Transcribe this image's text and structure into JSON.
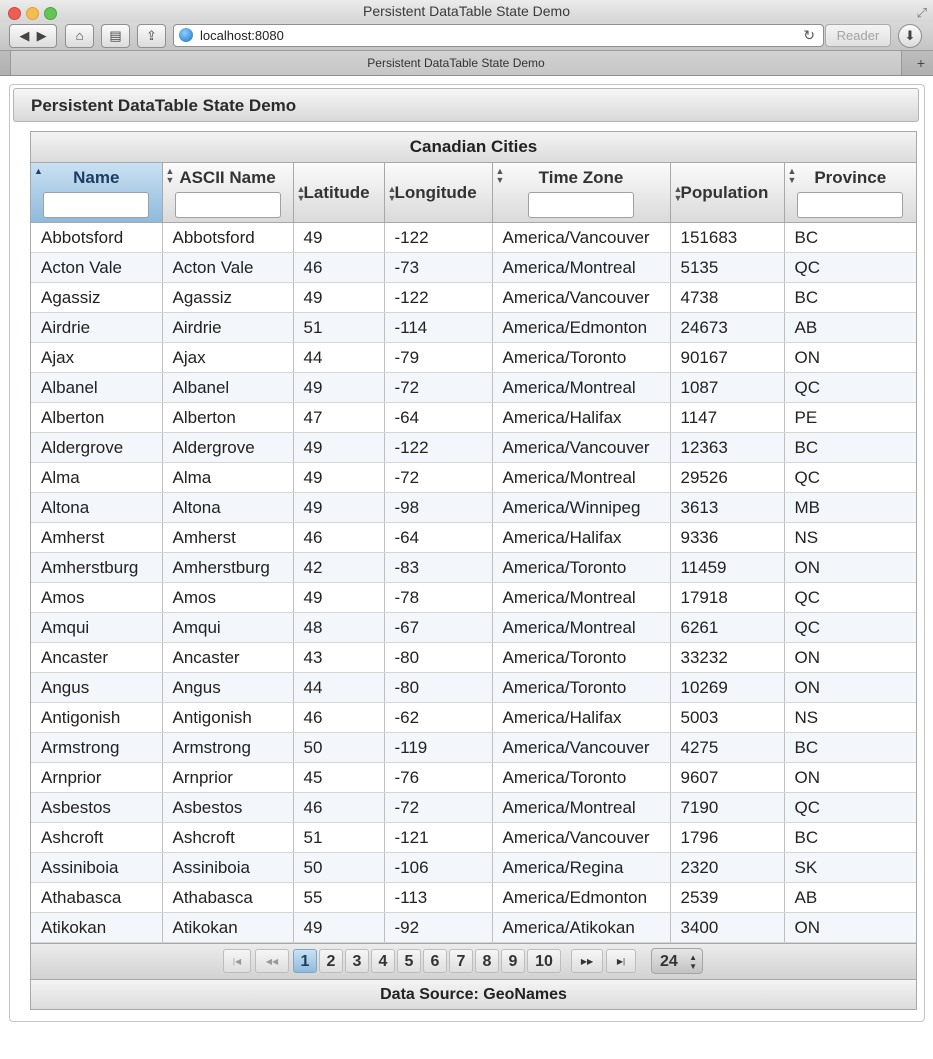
{
  "window": {
    "title": "Persistent DataTable State Demo"
  },
  "toolbar": {
    "back_icon": "back-arrow-icon",
    "forward_icon": "forward-arrow-icon",
    "url": "localhost:8080",
    "reader_label": "Reader"
  },
  "tab": {
    "title": "Persistent DataTable State Demo"
  },
  "panel": {
    "title": "Persistent DataTable State Demo"
  },
  "table": {
    "caption": "Canadian Cities",
    "columns": [
      "Name",
      "ASCII Name",
      "Latitude",
      "Longitude",
      "Time Zone",
      "Population",
      "Province"
    ],
    "rows": [
      [
        "Abbotsford",
        "Abbotsford",
        "49",
        "-122",
        "America/Vancouver",
        "151683",
        "BC"
      ],
      [
        "Acton Vale",
        "Acton Vale",
        "46",
        "-73",
        "America/Montreal",
        "5135",
        "QC"
      ],
      [
        "Agassiz",
        "Agassiz",
        "49",
        "-122",
        "America/Vancouver",
        "4738",
        "BC"
      ],
      [
        "Airdrie",
        "Airdrie",
        "51",
        "-114",
        "America/Edmonton",
        "24673",
        "AB"
      ],
      [
        "Ajax",
        "Ajax",
        "44",
        "-79",
        "America/Toronto",
        "90167",
        "ON"
      ],
      [
        "Albanel",
        "Albanel",
        "49",
        "-72",
        "America/Montreal",
        "1087",
        "QC"
      ],
      [
        "Alberton",
        "Alberton",
        "47",
        "-64",
        "America/Halifax",
        "1147",
        "PE"
      ],
      [
        "Aldergrove",
        "Aldergrove",
        "49",
        "-122",
        "America/Vancouver",
        "12363",
        "BC"
      ],
      [
        "Alma",
        "Alma",
        "49",
        "-72",
        "America/Montreal",
        "29526",
        "QC"
      ],
      [
        "Altona",
        "Altona",
        "49",
        "-98",
        "America/Winnipeg",
        "3613",
        "MB"
      ],
      [
        "Amherst",
        "Amherst",
        "46",
        "-64",
        "America/Halifax",
        "9336",
        "NS"
      ],
      [
        "Amherstburg",
        "Amherstburg",
        "42",
        "-83",
        "America/Toronto",
        "11459",
        "ON"
      ],
      [
        "Amos",
        "Amos",
        "49",
        "-78",
        "America/Montreal",
        "17918",
        "QC"
      ],
      [
        "Amqui",
        "Amqui",
        "48",
        "-67",
        "America/Montreal",
        "6261",
        "QC"
      ],
      [
        "Ancaster",
        "Ancaster",
        "43",
        "-80",
        "America/Toronto",
        "33232",
        "ON"
      ],
      [
        "Angus",
        "Angus",
        "44",
        "-80",
        "America/Toronto",
        "10269",
        "ON"
      ],
      [
        "Antigonish",
        "Antigonish",
        "46",
        "-62",
        "America/Halifax",
        "5003",
        "NS"
      ],
      [
        "Armstrong",
        "Armstrong",
        "50",
        "-119",
        "America/Vancouver",
        "4275",
        "BC"
      ],
      [
        "Arnprior",
        "Arnprior",
        "45",
        "-76",
        "America/Toronto",
        "9607",
        "ON"
      ],
      [
        "Asbestos",
        "Asbestos",
        "46",
        "-72",
        "America/Montreal",
        "7190",
        "QC"
      ],
      [
        "Ashcroft",
        "Ashcroft",
        "51",
        "-121",
        "America/Vancouver",
        "1796",
        "BC"
      ],
      [
        "Assiniboia",
        "Assiniboia",
        "50",
        "-106",
        "America/Regina",
        "2320",
        "SK"
      ],
      [
        "Athabasca",
        "Athabasca",
        "55",
        "-113",
        "America/Edmonton",
        "2539",
        "AB"
      ],
      [
        "Atikokan",
        "Atikokan",
        "49",
        "-92",
        "America/Atikokan",
        "3400",
        "ON"
      ]
    ]
  },
  "paginator": {
    "pages": [
      "1",
      "2",
      "3",
      "4",
      "5",
      "6",
      "7",
      "8",
      "9",
      "10"
    ],
    "current_page": "1",
    "rows_per_page": "24"
  },
  "footer": {
    "text": "Data Source: GeoNames"
  }
}
